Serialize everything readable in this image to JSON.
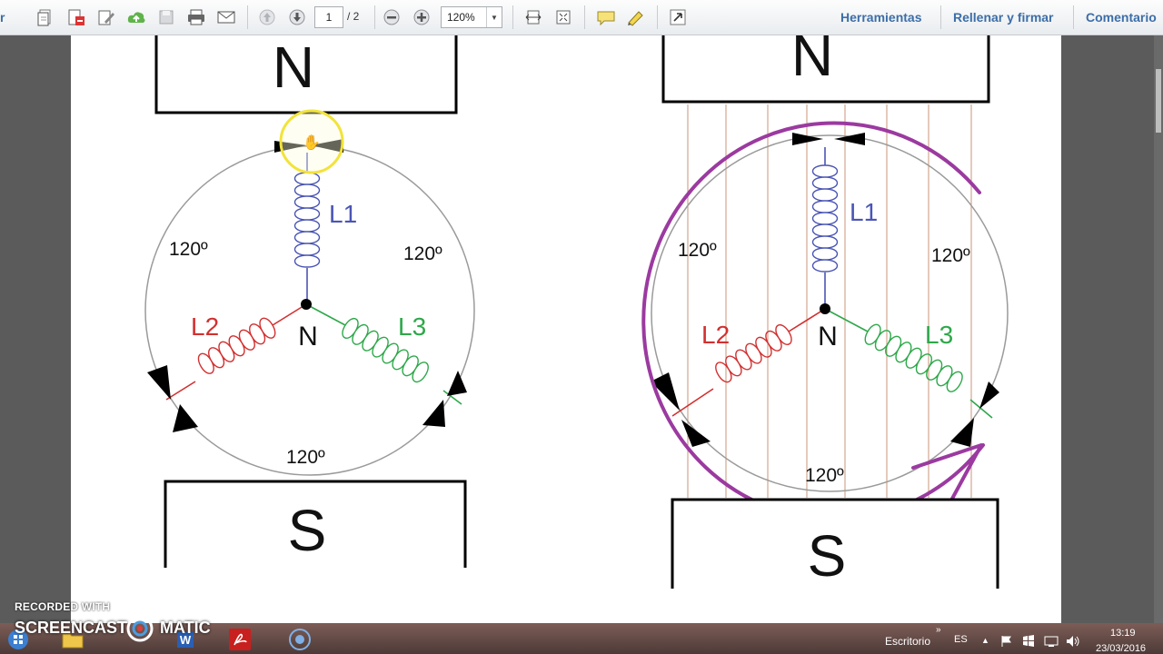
{
  "toolbar": {
    "left_clip_text": "r",
    "page_current": "1",
    "page_total": "/ 2",
    "zoom_value": "120%",
    "tools_label": "Herramientas",
    "fill_sign_label": "Rellenar y firmar",
    "comment_label": "Comentario"
  },
  "diagram_left": {
    "north_label": "N",
    "south_label": "S",
    "l1": "L1",
    "l2": "L2",
    "l3": "L3",
    "neutral": "N",
    "angle_left": "120º",
    "angle_right": "120º",
    "angle_bottom": "120º"
  },
  "diagram_right": {
    "north_label": "N",
    "south_label": "S",
    "l1": "L1",
    "l2": "L2",
    "l3": "L3",
    "neutral": "N",
    "angle_left": "120º",
    "angle_right": "120º",
    "angle_bottom": "120º"
  },
  "watermark": {
    "line1": "RECORDED WITH",
    "line2a": "SCREENCAST",
    "line2b": "MATIC"
  },
  "taskbar": {
    "desktop_label": "Escritorio",
    "language": "ES",
    "time": "13:19",
    "date": "23/03/2016"
  },
  "colors": {
    "coil_l1": "#4a55b5",
    "coil_l2": "#d23030",
    "coil_l3": "#2ea84a",
    "rotation_arrow": "#9b3aa0",
    "field_lines": "#c9957a",
    "cursor_highlight": "#f2e33a",
    "link_blue": "#3c6ea8"
  }
}
